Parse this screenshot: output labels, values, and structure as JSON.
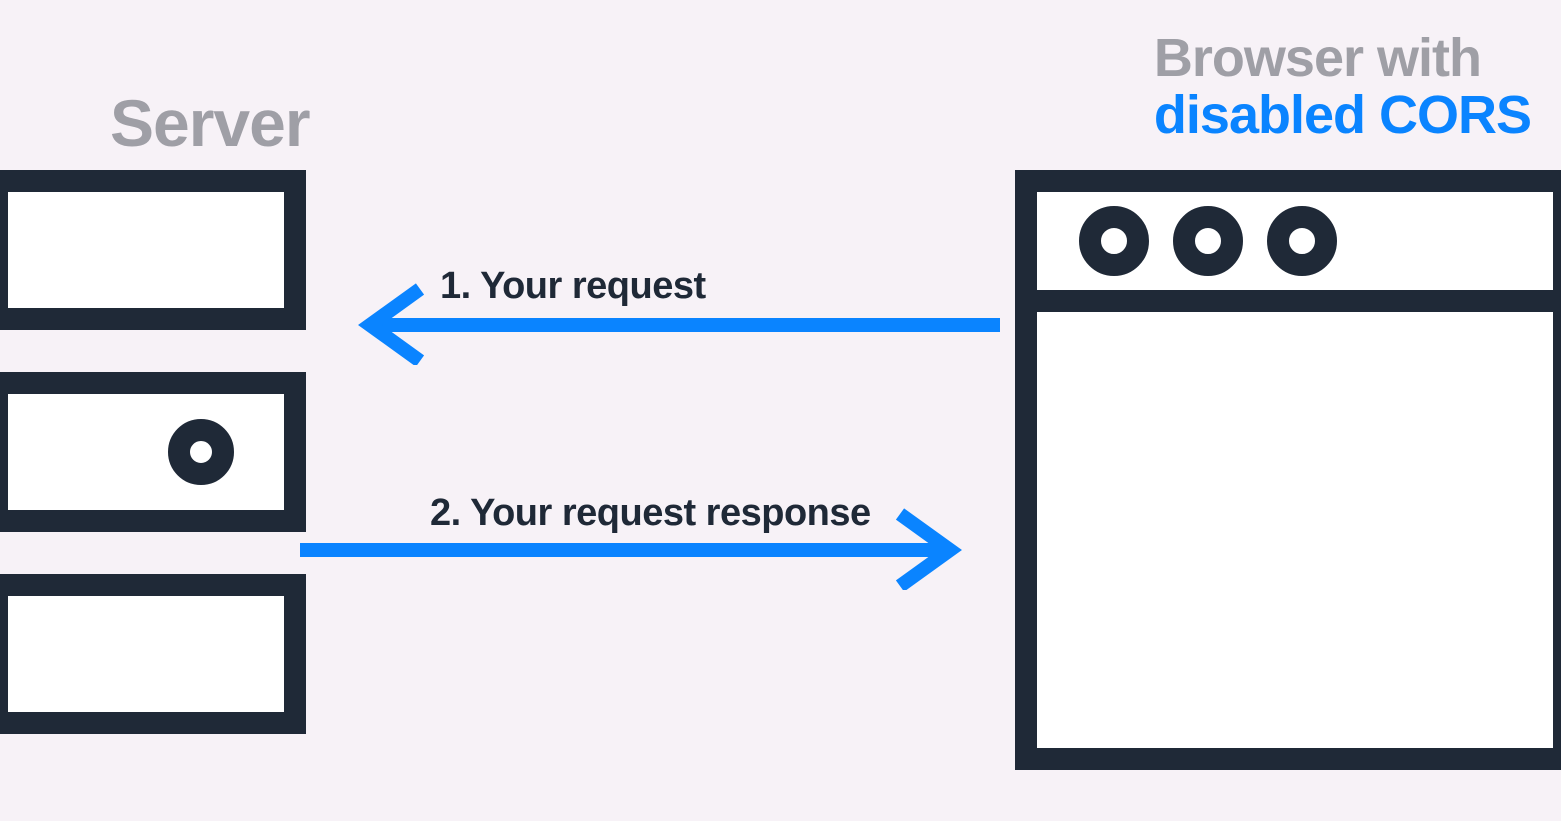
{
  "server": {
    "title": "Server"
  },
  "browser": {
    "title_line1": "Browser with",
    "title_line2": "disabled CORS"
  },
  "arrows": {
    "request": {
      "label": "1. Your request"
    },
    "response": {
      "label": "2. Your request response"
    }
  },
  "colors": {
    "accent": "#0a84ff",
    "stroke": "#1f2937",
    "muted": "#9f9fa6",
    "bg": "#f7f2f7"
  }
}
